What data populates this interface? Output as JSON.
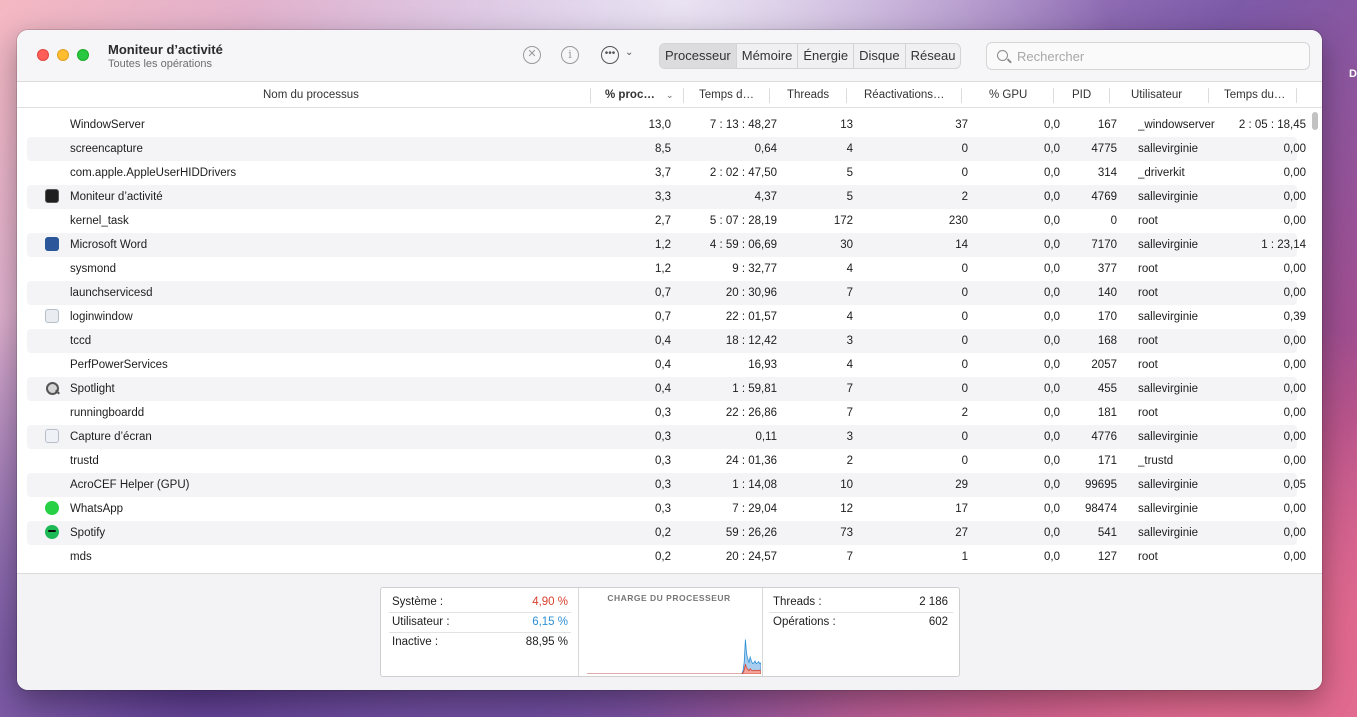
{
  "desktop_edge_letter": "D",
  "window": {
    "title": "Moniteur d’activité",
    "subtitle": "Toutes les opérations"
  },
  "toolbar": {
    "stop_icon": "x-circle-icon",
    "info_icon": "info-circle-icon",
    "more_icon": "ellipsis-circle-icon",
    "tabs": [
      "Processeur",
      "Mémoire",
      "Énergie",
      "Disque",
      "Réseau"
    ],
    "active_tab": "Processeur",
    "search_placeholder": "Rechercher"
  },
  "table": {
    "columns": [
      "Nom du processus",
      "% proc…",
      "Temps d…",
      "Threads",
      "Réactivations…",
      "% GPU",
      "PID",
      "Utilisateur",
      "Temps du…"
    ],
    "rows": [
      {
        "icon": "",
        "name": "WindowServer",
        "cpu": "13,0",
        "time": "7 : 13 : 48,27",
        "threads": "13",
        "wakeups": "37",
        "gpu": "0,0",
        "pid": "167",
        "user": "_windowserver",
        "gputime": "2 : 05 : 18,45"
      },
      {
        "icon": "",
        "name": "screencapture",
        "cpu": "8,5",
        "time": "0,64",
        "threads": "4",
        "wakeups": "0",
        "gpu": "0,0",
        "pid": "4775",
        "user": "sallevirginie",
        "gputime": "0,00"
      },
      {
        "icon": "",
        "name": "com.apple.AppleUserHIDDrivers",
        "cpu": "3,7",
        "time": "2 : 02 : 47,50",
        "threads": "5",
        "wakeups": "0",
        "gpu": "0,0",
        "pid": "314",
        "user": "_driverkit",
        "gputime": "0,00"
      },
      {
        "icon": "activity-monitor-icon",
        "name": "Moniteur d’activité",
        "cpu": "3,3",
        "time": "4,37",
        "threads": "5",
        "wakeups": "2",
        "gpu": "0,0",
        "pid": "4769",
        "user": "sallevirginie",
        "gputime": "0,00"
      },
      {
        "icon": "",
        "name": "kernel_task",
        "cpu": "2,7",
        "time": "5 : 07 : 28,19",
        "threads": "172",
        "wakeups": "230",
        "gpu": "0,0",
        "pid": "0",
        "user": "root",
        "gputime": "0,00"
      },
      {
        "icon": "word-icon",
        "name": "Microsoft Word",
        "cpu": "1,2",
        "time": "4 : 59 : 06,69",
        "threads": "30",
        "wakeups": "14",
        "gpu": "0,0",
        "pid": "7170",
        "user": "sallevirginie",
        "gputime": "1 : 23,14"
      },
      {
        "icon": "",
        "name": "sysmond",
        "cpu": "1,2",
        "time": "9 : 32,77",
        "threads": "4",
        "wakeups": "0",
        "gpu": "0,0",
        "pid": "377",
        "user": "root",
        "gputime": "0,00"
      },
      {
        "icon": "",
        "name": "launchservicesd",
        "cpu": "0,7",
        "time": "20 : 30,96",
        "threads": "7",
        "wakeups": "0",
        "gpu": "0,0",
        "pid": "140",
        "user": "root",
        "gputime": "0,00"
      },
      {
        "icon": "loginwindow-icon",
        "name": "loginwindow",
        "cpu": "0,7",
        "time": "22 : 01,57",
        "threads": "4",
        "wakeups": "0",
        "gpu": "0,0",
        "pid": "170",
        "user": "sallevirginie",
        "gputime": "0,39"
      },
      {
        "icon": "",
        "name": "tccd",
        "cpu": "0,4",
        "time": "18 : 12,42",
        "threads": "3",
        "wakeups": "0",
        "gpu": "0,0",
        "pid": "168",
        "user": "root",
        "gputime": "0,00"
      },
      {
        "icon": "",
        "name": "PerfPowerServices",
        "cpu": "0,4",
        "time": "16,93",
        "threads": "4",
        "wakeups": "0",
        "gpu": "0,0",
        "pid": "2057",
        "user": "root",
        "gputime": "0,00"
      },
      {
        "icon": "spotlight-icon",
        "name": "Spotlight",
        "cpu": "0,4",
        "time": "1 : 59,81",
        "threads": "7",
        "wakeups": "0",
        "gpu": "0,0",
        "pid": "455",
        "user": "sallevirginie",
        "gputime": "0,00"
      },
      {
        "icon": "",
        "name": "runningboardd",
        "cpu": "0,3",
        "time": "22 : 26,86",
        "threads": "7",
        "wakeups": "2",
        "gpu": "0,0",
        "pid": "181",
        "user": "root",
        "gputime": "0,00"
      },
      {
        "icon": "screenshot-icon",
        "name": "Capture d’écran",
        "cpu": "0,3",
        "time": "0,11",
        "threads": "3",
        "wakeups": "0",
        "gpu": "0,0",
        "pid": "4776",
        "user": "sallevirginie",
        "gputime": "0,00"
      },
      {
        "icon": "",
        "name": "trustd",
        "cpu": "0,3",
        "time": "24 : 01,36",
        "threads": "2",
        "wakeups": "0",
        "gpu": "0,0",
        "pid": "171",
        "user": "_trustd",
        "gputime": "0,00"
      },
      {
        "icon": "",
        "name": "AcroCEF Helper (GPU)",
        "cpu": "0,3",
        "time": "1 : 14,08",
        "threads": "10",
        "wakeups": "29",
        "gpu": "0,0",
        "pid": "99695",
        "user": "sallevirginie",
        "gputime": "0,05"
      },
      {
        "icon": "whatsapp-icon",
        "name": "WhatsApp",
        "cpu": "0,3",
        "time": "7 : 29,04",
        "threads": "12",
        "wakeups": "17",
        "gpu": "0,0",
        "pid": "98474",
        "user": "sallevirginie",
        "gputime": "0,00"
      },
      {
        "icon": "spotify-icon",
        "name": "Spotify",
        "cpu": "0,2",
        "time": "59 : 26,26",
        "threads": "73",
        "wakeups": "27",
        "gpu": "0,0",
        "pid": "541",
        "user": "sallevirginie",
        "gputime": "0,00"
      },
      {
        "icon": "",
        "name": "mds",
        "cpu": "0,2",
        "time": "20 : 24,57",
        "threads": "7",
        "wakeups": "1",
        "gpu": "0,0",
        "pid": "127",
        "user": "root",
        "gputime": "0,00"
      }
    ]
  },
  "summary": {
    "system_label": "Système :",
    "system_value": "4,90 %",
    "system_color": "#d9412e",
    "user_label": "Utilisateur :",
    "user_value": "6,15 %",
    "user_color": "#2d8fd5",
    "idle_label": "Inactive :",
    "idle_value": "88,95 %",
    "chart_title": "CHARGE DU PROCESSEUR",
    "threads_label": "Threads :",
    "threads_value": "2 186",
    "processes_label": "Opérations :",
    "processes_value": "602"
  },
  "chart_data": {
    "type": "area",
    "title": "CHARGE DU PROCESSEUR",
    "xlabel": "",
    "ylabel": "",
    "ylim": [
      0,
      100
    ],
    "grid": false,
    "series": [
      {
        "name": "",
        "color": "#2d8fd5",
        "values": [
          0,
          0,
          0,
          0,
          0,
          0,
          0,
          0,
          0,
          0,
          0,
          0,
          0,
          0,
          0,
          0,
          0,
          0,
          0,
          0,
          0,
          0,
          0,
          0,
          0,
          0,
          0,
          0,
          0,
          0,
          0,
          0,
          0,
          0,
          0,
          0,
          0,
          0,
          0,
          0,
          0,
          0,
          0,
          0,
          0,
          0,
          0,
          0,
          0,
          0,
          0,
          0,
          0,
          0,
          0,
          0,
          0,
          0,
          0,
          0,
          0,
          0,
          0,
          0,
          0,
          0,
          0,
          0,
          0,
          0,
          0,
          0,
          0,
          0,
          0,
          0,
          0,
          0,
          0,
          0,
          0,
          0,
          0,
          0,
          0,
          0,
          0,
          0,
          0,
          0,
          0,
          0,
          0,
          0,
          0,
          0,
          0,
          0,
          0,
          0,
          0,
          0,
          0,
          0,
          0,
          0,
          0,
          0,
          0,
          0,
          0,
          0,
          0,
          0,
          0,
          0,
          0,
          0,
          0,
          0,
          0,
          0,
          0,
          0,
          0,
          0,
          0,
          0,
          0,
          0,
          3,
          12,
          38,
          22,
          16,
          13,
          18,
          14,
          11,
          12,
          14,
          11,
          12,
          13,
          11,
          12
        ]
      },
      {
        "name": "",
        "color": "#d9412e",
        "values": [
          0,
          0,
          0,
          0,
          0,
          0,
          0,
          0,
          0,
          0,
          0,
          0,
          0,
          0,
          0,
          0,
          0,
          0,
          0,
          0,
          0,
          0,
          0,
          0,
          0,
          0,
          0,
          0,
          0,
          0,
          0,
          0,
          0,
          0,
          0,
          0,
          0,
          0,
          0,
          0,
          0,
          0,
          0,
          0,
          0,
          0,
          0,
          0,
          0,
          0,
          0,
          0,
          0,
          0,
          0,
          0,
          0,
          0,
          0,
          0,
          0,
          0,
          0,
          0,
          0,
          0,
          0,
          0,
          0,
          0,
          0,
          0,
          0,
          0,
          0,
          0,
          0,
          0,
          0,
          0,
          0,
          0,
          0,
          0,
          0,
          0,
          0,
          0,
          0,
          0,
          0,
          0,
          0,
          0,
          0,
          0,
          0,
          0,
          0,
          0,
          0,
          0,
          0,
          0,
          0,
          0,
          0,
          0,
          0,
          0,
          0,
          0,
          0,
          0,
          0,
          0,
          0,
          0,
          0,
          0,
          0,
          0,
          0,
          0,
          0,
          0,
          0,
          0,
          0,
          0,
          2,
          6,
          15,
          9,
          7,
          5,
          8,
          6,
          5,
          5,
          6,
          5,
          5,
          6,
          5,
          5
        ]
      }
    ]
  }
}
